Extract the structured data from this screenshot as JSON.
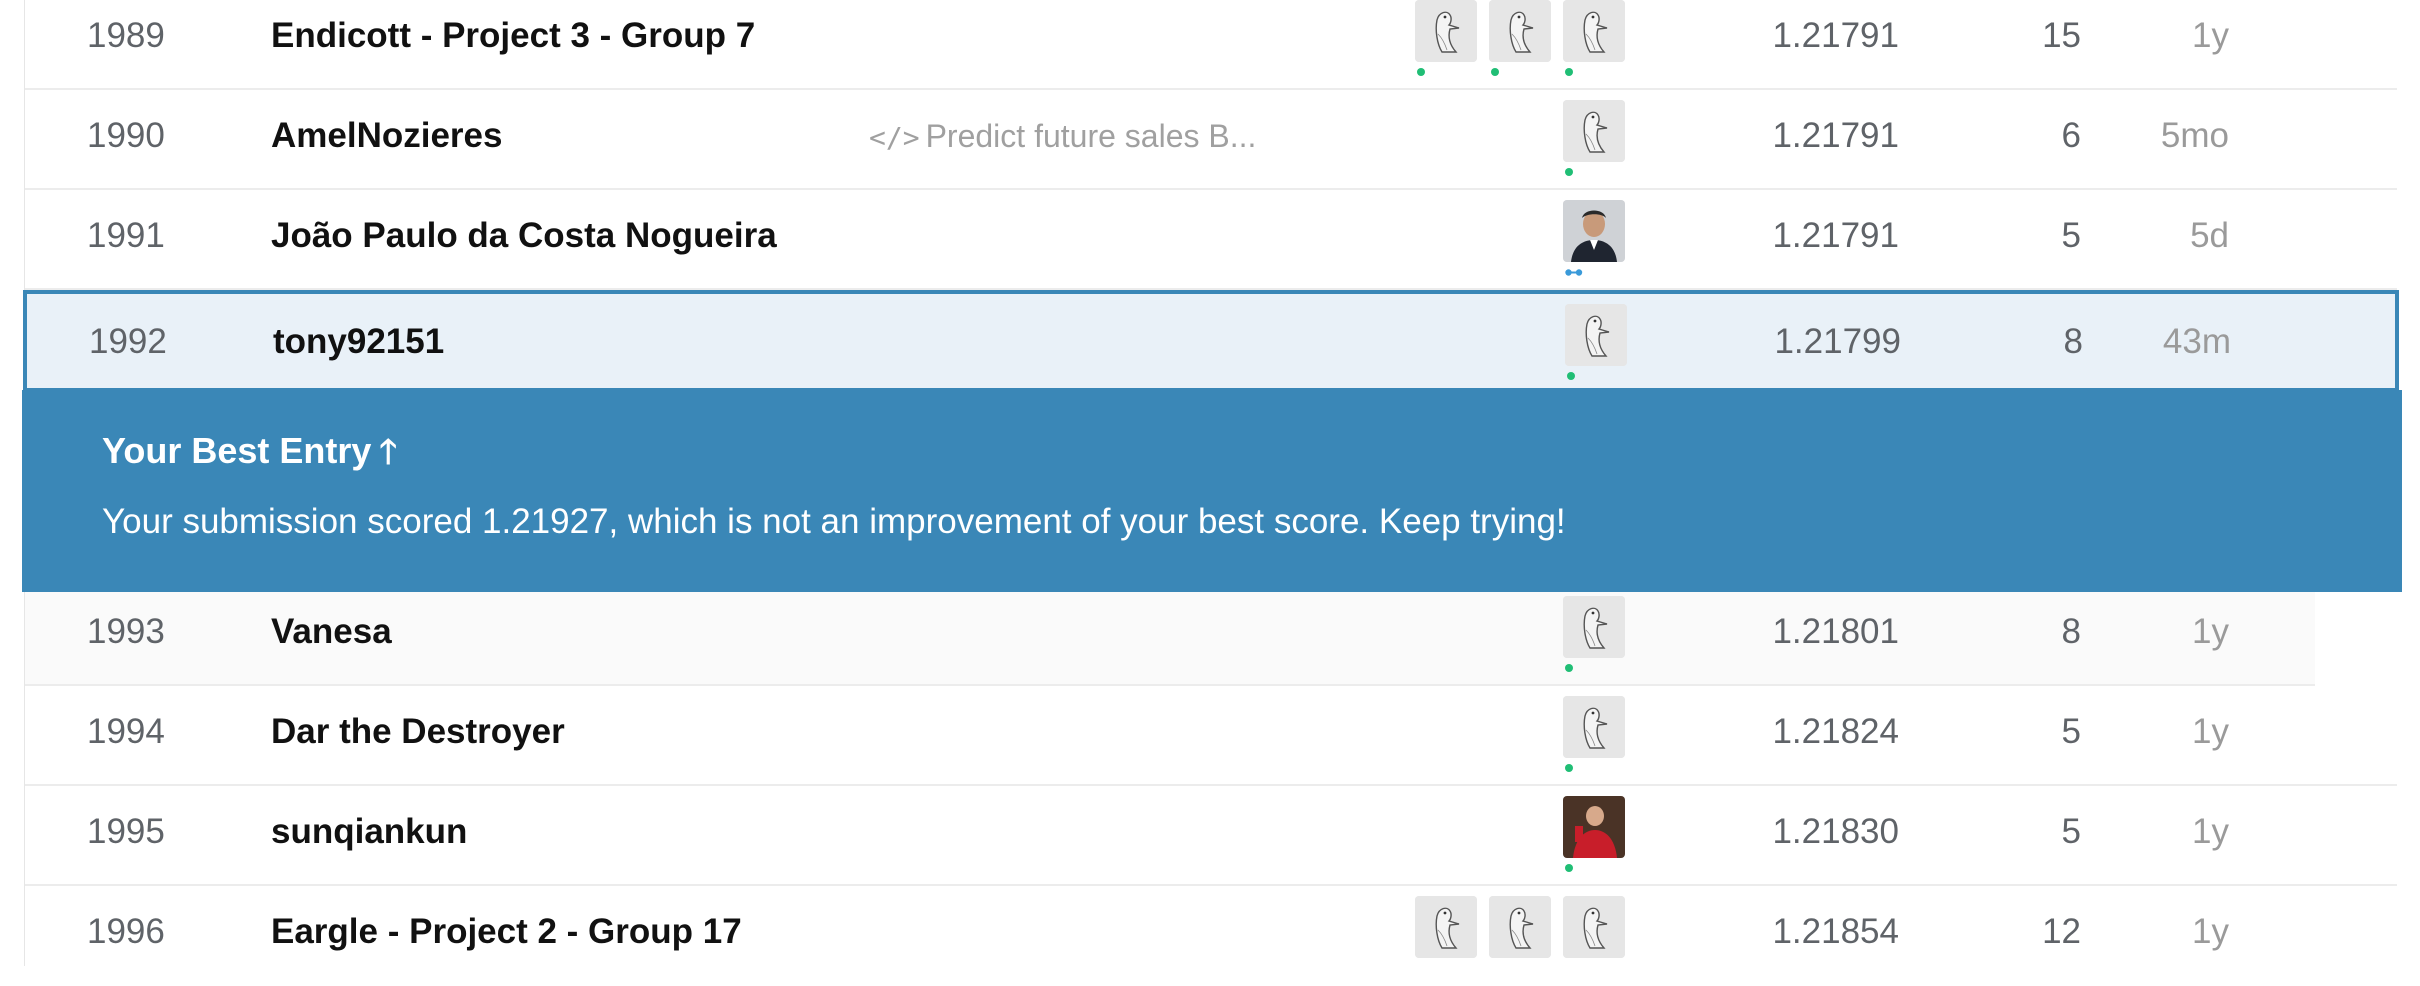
{
  "rows_above": [
    {
      "rank": "1989",
      "name": "Endicott - Project 3 - Group 7",
      "kernel": "",
      "avatars": [
        "goose",
        "goose",
        "goose"
      ],
      "score": "1.21791",
      "entries": "15",
      "last": "1y"
    },
    {
      "rank": "1990",
      "name": "AmelNozieres",
      "kernel": "Predict future sales B...",
      "avatars": [
        "goose"
      ],
      "score": "1.21791",
      "entries": "6",
      "last": "5mo"
    },
    {
      "rank": "1991",
      "name": "João Paulo da Costa Nogueira",
      "kernel": "",
      "avatars": [
        "photo-man"
      ],
      "score": "1.21791",
      "entries": "5",
      "last": "5d"
    }
  ],
  "my_row": {
    "rank": "1992",
    "name": "tony92151",
    "kernel": "",
    "avatars": [
      "goose"
    ],
    "score": "1.21799",
    "entries": "8",
    "last": "43m"
  },
  "banner": {
    "title": "Your Best Entry",
    "arrow_icon": "arrow-up-icon",
    "message": "Your submission scored 1.21927, which is not an improvement of your best score. Keep trying!"
  },
  "rows_below": [
    {
      "rank": "1993",
      "name": "Vanesa",
      "kernel": "",
      "avatars": [
        "goose"
      ],
      "score": "1.21801",
      "entries": "8",
      "last": "1y"
    },
    {
      "rank": "1994",
      "name": "Dar the Destroyer",
      "kernel": "",
      "avatars": [
        "goose"
      ],
      "score": "1.21824",
      "entries": "5",
      "last": "1y"
    },
    {
      "rank": "1995",
      "name": "sunqiankun",
      "kernel": "",
      "avatars": [
        "photo-red"
      ],
      "score": "1.21830",
      "entries": "5",
      "last": "1y"
    },
    {
      "rank": "1996",
      "name": "Eargle - Project 2 - Group 17",
      "kernel": "",
      "avatars": [
        "goose",
        "goose",
        "goose"
      ],
      "score": "1.21854",
      "entries": "12",
      "last": "1y"
    }
  ],
  "colors": {
    "accent": "#3a87b7",
    "highlight_row": "#e9f1f8",
    "online_dot": "#20be75",
    "secondary_text": "#5f6368"
  }
}
